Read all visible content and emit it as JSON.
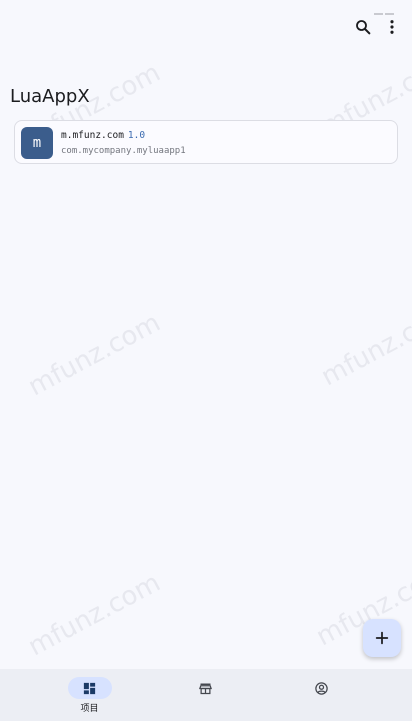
{
  "app": {
    "title": "LuaAppX"
  },
  "toolbar": {
    "search_icon": "search-icon",
    "more_icon": "more-vert-icon"
  },
  "projects": [
    {
      "avatar_letter": "m",
      "name": "m.mfunz.com",
      "version": "1.0",
      "package": "com.mycompany.myluaapp1"
    }
  ],
  "watermark": {
    "text": "mfunz.com"
  },
  "fab": {
    "icon": "add-icon"
  },
  "bottom_nav": {
    "items": [
      {
        "icon": "dashboard-icon",
        "label": "项目",
        "active": true
      },
      {
        "icon": "store-icon",
        "label": "",
        "active": false
      },
      {
        "icon": "account-circle-icon",
        "label": "",
        "active": false
      }
    ]
  },
  "colors": {
    "background": "#f7f8fd",
    "accent": "#3b5d8c",
    "fab_bg": "#d7e2ff",
    "nav_bg": "#eceef4",
    "version": "#3b6bb0"
  }
}
